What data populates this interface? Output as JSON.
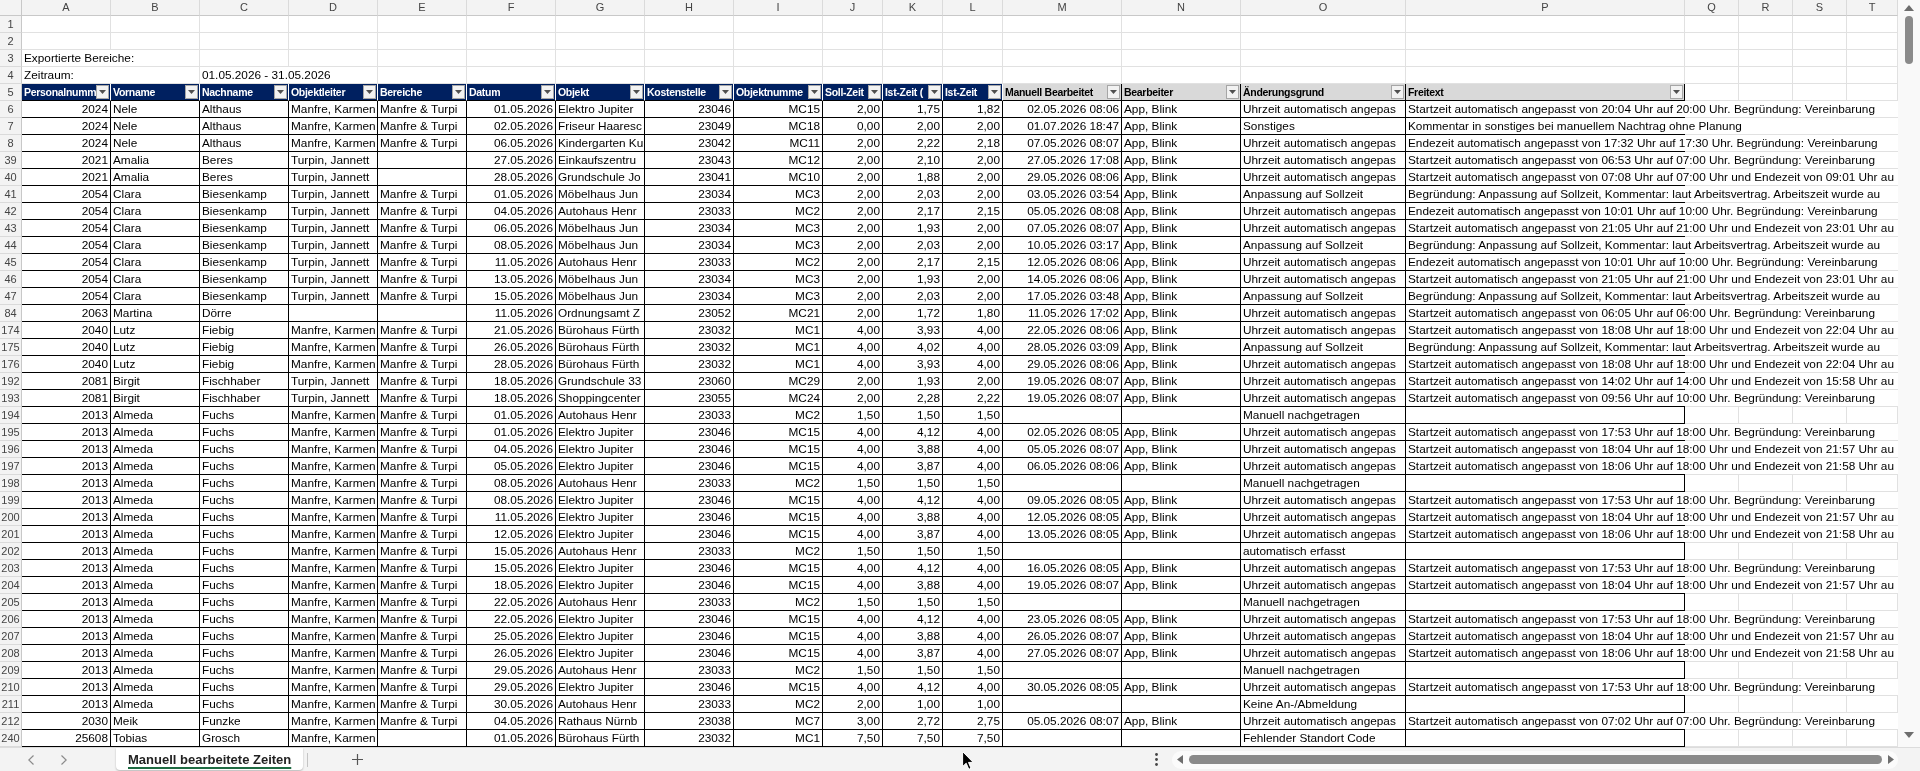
{
  "sheet": {
    "column_letters": [
      "A",
      "B",
      "C",
      "D",
      "E",
      "F",
      "G",
      "H",
      "I",
      "J",
      "K",
      "L",
      "M",
      "N",
      "O",
      "P",
      "Q",
      "R",
      "S",
      "T"
    ],
    "rows": [
      {
        "number": "1"
      },
      {
        "number": "2"
      },
      {
        "number": "3",
        "label": "Exportierte Bereiche:"
      },
      {
        "number": "4",
        "label": "Zeitraum:",
        "value": "01.05.2026 - 31.05.2026"
      }
    ],
    "table": {
      "number": "5",
      "columns": [
        {
          "label": "Personalnumm",
          "color": "#002060"
        },
        {
          "label": "Vorname",
          "color": "#002060"
        },
        {
          "label": "Nachname",
          "color": "#002060"
        },
        {
          "label": "Objektleiter",
          "color": "#002060"
        },
        {
          "label": "Bereiche",
          "color": "#002060"
        },
        {
          "label": "Datum",
          "color": "#002060"
        },
        {
          "label": "Objekt",
          "color": "#002060"
        },
        {
          "label": "Kostenstelle",
          "color": "#002060"
        },
        {
          "label": "Objektnumme",
          "color": "#002060"
        },
        {
          "label": "Soll-Zeit",
          "color": "#002060"
        },
        {
          "label": "Ist-Zeit (",
          "color": "#002060"
        },
        {
          "label": "Ist-Zeit",
          "color": "#002060"
        },
        {
          "label": "Manuell Bearbeitet",
          "color": "#d9d9d9"
        },
        {
          "label": "Bearbeiter",
          "color": "#d9d9d9"
        },
        {
          "label": "Änderungsgrund",
          "color": "#d9d9d9"
        },
        {
          "label": "Freitext",
          "color": "#d9d9d9"
        }
      ],
      "rows": [
        {
          "number": "6",
          "cells": [
            "2024",
            "Nele",
            "Althaus",
            "Manfre, Karmen",
            "Manfre & Turpi",
            "01.05.2026",
            "Elektro Jupiter",
            "23046",
            "MC15",
            "2,00",
            "1,75",
            "1,82",
            "02.05.2026 08:06",
            "App, Blink",
            "Uhrzeit automatisch angepas",
            "Startzeit automatisch angepasst von 20:04 Uhr auf 20:00 Uhr. Begründung: Vereinbarung"
          ]
        },
        {
          "number": "7",
          "cells": [
            "2024",
            "Nele",
            "Althaus",
            "Manfre, Karmen",
            "Manfre & Turpi",
            "02.05.2026",
            "Friseur Haaresc",
            "23049",
            "MC18",
            "0,00",
            "2,00",
            "2,00",
            "01.07.2026 18:47",
            "App, Blink",
            "Sonstiges",
            "Kommentar in sonstiges bei manuellem Nachtrag ohne Planung"
          ]
        },
        {
          "number": "8",
          "cells": [
            "2024",
            "Nele",
            "Althaus",
            "Manfre, Karmen",
            "Manfre & Turpi",
            "06.05.2026",
            "Kindergarten Ku",
            "23042",
            "MC11",
            "2,00",
            "2,22",
            "2,18",
            "07.05.2026 08:07",
            "App, Blink",
            "Uhrzeit automatisch angepas",
            "Endezeit automatisch angepasst von 17:32 Uhr auf 17:30 Uhr. Begründung: Vereinbarung"
          ]
        },
        {
          "number": "39",
          "cells": [
            "2021",
            "Amalia",
            "Beres",
            "Turpin, Jannett",
            null,
            "27.05.2026",
            "Einkaufszentru",
            "23043",
            "MC12",
            "2,00",
            "2,10",
            "2,00",
            "27.05.2026 17:08",
            "App, Blink",
            "Uhrzeit automatisch angepas",
            "Startzeit automatisch angepasst von 06:53 Uhr auf 07:00 Uhr. Begründung: Vereinbarung"
          ]
        },
        {
          "number": "40",
          "cells": [
            "2021",
            "Amalia",
            "Beres",
            "Turpin, Jannett",
            null,
            "28.05.2026",
            "Grundschule Jo",
            "23041",
            "MC10",
            "2,00",
            "1,88",
            "2,00",
            "29.05.2026 08:06",
            "App, Blink",
            "Uhrzeit automatisch angepas",
            "Startzeit automatisch angepasst von 07:08 Uhr auf 07:00 Uhr und Endezeit von 09:01 Uhr au"
          ]
        },
        {
          "number": "41",
          "cells": [
            "2054",
            "Clara",
            "Biesenkamp",
            "Turpin, Jannett",
            "Manfre & Turpi",
            "01.05.2026",
            "Möbelhaus Jun",
            "23034",
            "MC3",
            "2,00",
            "2,03",
            "2,00",
            "03.05.2026 03:54",
            "App, Blink",
            "Anpassung auf Sollzeit",
            "Begründung: Anpassung auf Sollzeit, Kommentar: laut Arbeitsvertrag. Arbeitszeit wurde au"
          ]
        },
        {
          "number": "42",
          "cells": [
            "2054",
            "Clara",
            "Biesenkamp",
            "Turpin, Jannett",
            "Manfre & Turpi",
            "04.05.2026",
            "Autohaus Henr",
            "23033",
            "MC2",
            "2,00",
            "2,17",
            "2,15",
            "05.05.2026 08:08",
            "App, Blink",
            "Uhrzeit automatisch angepas",
            "Endezeit automatisch angepasst von 10:01 Uhr auf 10:00 Uhr. Begründung: Vereinbarung"
          ]
        },
        {
          "number": "43",
          "cells": [
            "2054",
            "Clara",
            "Biesenkamp",
            "Turpin, Jannett",
            "Manfre & Turpi",
            "06.05.2026",
            "Möbelhaus Jun",
            "23034",
            "MC3",
            "2,00",
            "1,93",
            "2,00",
            "07.05.2026 08:07",
            "App, Blink",
            "Uhrzeit automatisch angepas",
            "Startzeit automatisch angepasst von 21:05 Uhr auf 21:00 Uhr und Endezeit von 23:01 Uhr au"
          ]
        },
        {
          "number": "44",
          "cells": [
            "2054",
            "Clara",
            "Biesenkamp",
            "Turpin, Jannett",
            "Manfre & Turpi",
            "08.05.2026",
            "Möbelhaus Jun",
            "23034",
            "MC3",
            "2,00",
            "2,03",
            "2,00",
            "10.05.2026 03:17",
            "App, Blink",
            "Anpassung auf Sollzeit",
            "Begründung: Anpassung auf Sollzeit, Kommentar: laut Arbeitsvertrag. Arbeitszeit wurde au"
          ]
        },
        {
          "number": "45",
          "cells": [
            "2054",
            "Clara",
            "Biesenkamp",
            "Turpin, Jannett",
            "Manfre & Turpi",
            "11.05.2026",
            "Autohaus Henr",
            "23033",
            "MC2",
            "2,00",
            "2,17",
            "2,15",
            "12.05.2026 08:06",
            "App, Blink",
            "Uhrzeit automatisch angepas",
            "Endezeit automatisch angepasst von 10:01 Uhr auf 10:00 Uhr. Begründung: Vereinbarung"
          ]
        },
        {
          "number": "46",
          "cells": [
            "2054",
            "Clara",
            "Biesenkamp",
            "Turpin, Jannett",
            "Manfre & Turpi",
            "13.05.2026",
            "Möbelhaus Jun",
            "23034",
            "MC3",
            "2,00",
            "1,93",
            "2,00",
            "14.05.2026 08:06",
            "App, Blink",
            "Uhrzeit automatisch angepas",
            "Startzeit automatisch angepasst von 21:05 Uhr auf 21:00 Uhr und Endezeit von 23:01 Uhr au"
          ]
        },
        {
          "number": "47",
          "cells": [
            "2054",
            "Clara",
            "Biesenkamp",
            "Turpin, Jannett",
            "Manfre & Turpi",
            "15.05.2026",
            "Möbelhaus Jun",
            "23034",
            "MC3",
            "2,00",
            "2,03",
            "2,00",
            "17.05.2026 03:48",
            "App, Blink",
            "Anpassung auf Sollzeit",
            "Begründung: Anpassung auf Sollzeit, Kommentar: laut Arbeitsvertrag. Arbeitszeit wurde au"
          ]
        },
        {
          "number": "84",
          "cells": [
            "2063",
            "Martina",
            "Dörre",
            null,
            null,
            "11.05.2026",
            "Ordnungsamt Z",
            "23052",
            "MC21",
            "2,00",
            "1,72",
            "1,80",
            "11.05.2026 17:02",
            "App, Blink",
            "Uhrzeit automatisch angepas",
            "Startzeit automatisch angepasst von 06:05 Uhr auf 06:00 Uhr. Begründung: Vereinbarung"
          ]
        },
        {
          "number": "174",
          "cells": [
            "2040",
            "Lutz",
            "Fiebig",
            "Manfre, Karmen",
            "Manfre & Turpi",
            "21.05.2026",
            "Bürohaus Fürth",
            "23032",
            "MC1",
            "4,00",
            "3,93",
            "4,00",
            "22.05.2026 08:06",
            "App, Blink",
            "Uhrzeit automatisch angepas",
            "Startzeit automatisch angepasst von 18:08 Uhr auf 18:00 Uhr und Endezeit von 22:04 Uhr au"
          ]
        },
        {
          "number": "175",
          "cells": [
            "2040",
            "Lutz",
            "Fiebig",
            "Manfre, Karmen",
            "Manfre & Turpi",
            "26.05.2026",
            "Bürohaus Fürth",
            "23032",
            "MC1",
            "4,00",
            "4,02",
            "4,00",
            "28.05.2026 03:09",
            "App, Blink",
            "Anpassung auf Sollzeit",
            "Begründung: Anpassung auf Sollzeit, Kommentar: laut Arbeitsvertrag. Arbeitszeit wurde au"
          ]
        },
        {
          "number": "176",
          "cells": [
            "2040",
            "Lutz",
            "Fiebig",
            "Manfre, Karmen",
            "Manfre & Turpi",
            "28.05.2026",
            "Bürohaus Fürth",
            "23032",
            "MC1",
            "4,00",
            "3,93",
            "4,00",
            "29.05.2026 08:06",
            "App, Blink",
            "Uhrzeit automatisch angepas",
            "Startzeit automatisch angepasst von 18:08 Uhr auf 18:00 Uhr und Endezeit von 22:04 Uhr au"
          ]
        },
        {
          "number": "192",
          "cells": [
            "2081",
            "Birgit",
            "Fischhaber",
            "Turpin, Jannett",
            "Manfre & Turpi",
            "18.05.2026",
            "Grundschule 33",
            "23060",
            "MC29",
            "2,00",
            "1,93",
            "2,00",
            "19.05.2026 08:07",
            "App, Blink",
            "Uhrzeit automatisch angepas",
            "Startzeit automatisch angepasst von 14:02 Uhr auf 14:00 Uhr und Endezeit von 15:58 Uhr au"
          ]
        },
        {
          "number": "193",
          "cells": [
            "2081",
            "Birgit",
            "Fischhaber",
            "Turpin, Jannett",
            "Manfre & Turpi",
            "18.05.2026",
            "Shoppingcenter",
            "23055",
            "MC24",
            "2,00",
            "2,28",
            "2,22",
            "19.05.2026 08:07",
            "App, Blink",
            "Uhrzeit automatisch angepas",
            "Startzeit automatisch angepasst von 09:56 Uhr auf 10:00 Uhr. Begründung: Vereinbarung"
          ]
        },
        {
          "number": "194",
          "cells": [
            "2013",
            "Almeda",
            "Fuchs",
            "Manfre, Karmen",
            "Manfre & Turpi",
            "01.05.2026",
            "Autohaus Henr",
            "23033",
            "MC2",
            "1,50",
            "1,50",
            "1,50",
            null,
            null,
            "Manuell nachgetragen",
            null
          ]
        },
        {
          "number": "195",
          "cells": [
            "2013",
            "Almeda",
            "Fuchs",
            "Manfre, Karmen",
            "Manfre & Turpi",
            "01.05.2026",
            "Elektro Jupiter",
            "23046",
            "MC15",
            "4,00",
            "4,12",
            "4,00",
            "02.05.2026 08:05",
            "App, Blink",
            "Uhrzeit automatisch angepas",
            "Startzeit automatisch angepasst von 17:53 Uhr auf 18:00 Uhr. Begründung: Vereinbarung"
          ]
        },
        {
          "number": "196",
          "cells": [
            "2013",
            "Almeda",
            "Fuchs",
            "Manfre, Karmen",
            "Manfre & Turpi",
            "04.05.2026",
            "Elektro Jupiter",
            "23046",
            "MC15",
            "4,00",
            "3,88",
            "4,00",
            "05.05.2026 08:07",
            "App, Blink",
            "Uhrzeit automatisch angepas",
            "Startzeit automatisch angepasst von 18:04 Uhr auf 18:00 Uhr und Endezeit von 21:57 Uhr au"
          ]
        },
        {
          "number": "197",
          "cells": [
            "2013",
            "Almeda",
            "Fuchs",
            "Manfre, Karmen",
            "Manfre & Turpi",
            "05.05.2026",
            "Elektro Jupiter",
            "23046",
            "MC15",
            "4,00",
            "3,87",
            "4,00",
            "06.05.2026 08:06",
            "App, Blink",
            "Uhrzeit automatisch angepas",
            "Startzeit automatisch angepasst von 18:06 Uhr auf 18:00 Uhr und Endezeit von 21:58 Uhr au"
          ]
        },
        {
          "number": "198",
          "cells": [
            "2013",
            "Almeda",
            "Fuchs",
            "Manfre, Karmen",
            "Manfre & Turpi",
            "08.05.2026",
            "Autohaus Henr",
            "23033",
            "MC2",
            "1,50",
            "1,50",
            "1,50",
            null,
            null,
            "Manuell nachgetragen",
            null
          ]
        },
        {
          "number": "199",
          "cells": [
            "2013",
            "Almeda",
            "Fuchs",
            "Manfre, Karmen",
            "Manfre & Turpi",
            "08.05.2026",
            "Elektro Jupiter",
            "23046",
            "MC15",
            "4,00",
            "4,12",
            "4,00",
            "09.05.2026 08:05",
            "App, Blink",
            "Uhrzeit automatisch angepas",
            "Startzeit automatisch angepasst von 17:53 Uhr auf 18:00 Uhr. Begründung: Vereinbarung"
          ]
        },
        {
          "number": "200",
          "cells": [
            "2013",
            "Almeda",
            "Fuchs",
            "Manfre, Karmen",
            "Manfre & Turpi",
            "11.05.2026",
            "Elektro Jupiter",
            "23046",
            "MC15",
            "4,00",
            "3,88",
            "4,00",
            "12.05.2026 08:05",
            "App, Blink",
            "Uhrzeit automatisch angepas",
            "Startzeit automatisch angepasst von 18:04 Uhr auf 18:00 Uhr und Endezeit von 21:57 Uhr au"
          ]
        },
        {
          "number": "201",
          "cells": [
            "2013",
            "Almeda",
            "Fuchs",
            "Manfre, Karmen",
            "Manfre & Turpi",
            "12.05.2026",
            "Elektro Jupiter",
            "23046",
            "MC15",
            "4,00",
            "3,87",
            "4,00",
            "13.05.2026 08:05",
            "App, Blink",
            "Uhrzeit automatisch angepas",
            "Startzeit automatisch angepasst von 18:06 Uhr auf 18:00 Uhr und Endezeit von 21:58 Uhr au"
          ]
        },
        {
          "number": "202",
          "cells": [
            "2013",
            "Almeda",
            "Fuchs",
            "Manfre, Karmen",
            "Manfre & Turpi",
            "15.05.2026",
            "Autohaus Henr",
            "23033",
            "MC2",
            "1,50",
            "1,50",
            "1,50",
            null,
            null,
            "automatisch erfasst",
            null
          ]
        },
        {
          "number": "203",
          "cells": [
            "2013",
            "Almeda",
            "Fuchs",
            "Manfre, Karmen",
            "Manfre & Turpi",
            "15.05.2026",
            "Elektro Jupiter",
            "23046",
            "MC15",
            "4,00",
            "4,12",
            "4,00",
            "16.05.2026 08:05",
            "App, Blink",
            "Uhrzeit automatisch angepas",
            "Startzeit automatisch angepasst von 17:53 Uhr auf 18:00 Uhr. Begründung: Vereinbarung"
          ]
        },
        {
          "number": "204",
          "cells": [
            "2013",
            "Almeda",
            "Fuchs",
            "Manfre, Karmen",
            "Manfre & Turpi",
            "18.05.2026",
            "Elektro Jupiter",
            "23046",
            "MC15",
            "4,00",
            "3,88",
            "4,00",
            "19.05.2026 08:07",
            "App, Blink",
            "Uhrzeit automatisch angepas",
            "Startzeit automatisch angepasst von 18:04 Uhr auf 18:00 Uhr und Endezeit von 21:57 Uhr au"
          ]
        },
        {
          "number": "205",
          "cells": [
            "2013",
            "Almeda",
            "Fuchs",
            "Manfre, Karmen",
            "Manfre & Turpi",
            "22.05.2026",
            "Autohaus Henr",
            "23033",
            "MC2",
            "1,50",
            "1,50",
            "1,50",
            null,
            null,
            "Manuell nachgetragen",
            null
          ]
        },
        {
          "number": "206",
          "cells": [
            "2013",
            "Almeda",
            "Fuchs",
            "Manfre, Karmen",
            "Manfre & Turpi",
            "22.05.2026",
            "Elektro Jupiter",
            "23046",
            "MC15",
            "4,00",
            "4,12",
            "4,00",
            "23.05.2026 08:05",
            "App, Blink",
            "Uhrzeit automatisch angepas",
            "Startzeit automatisch angepasst von 17:53 Uhr auf 18:00 Uhr. Begründung: Vereinbarung"
          ]
        },
        {
          "number": "207",
          "cells": [
            "2013",
            "Almeda",
            "Fuchs",
            "Manfre, Karmen",
            "Manfre & Turpi",
            "25.05.2026",
            "Elektro Jupiter",
            "23046",
            "MC15",
            "4,00",
            "3,88",
            "4,00",
            "26.05.2026 08:07",
            "App, Blink",
            "Uhrzeit automatisch angepas",
            "Startzeit automatisch angepasst von 18:04 Uhr auf 18:00 Uhr und Endezeit von 21:57 Uhr au"
          ]
        },
        {
          "number": "208",
          "cells": [
            "2013",
            "Almeda",
            "Fuchs",
            "Manfre, Karmen",
            "Manfre & Turpi",
            "26.05.2026",
            "Elektro Jupiter",
            "23046",
            "MC15",
            "4,00",
            "3,87",
            "4,00",
            "27.05.2026 08:07",
            "App, Blink",
            "Uhrzeit automatisch angepas",
            "Startzeit automatisch angepasst von 18:06 Uhr auf 18:00 Uhr und Endezeit von 21:58 Uhr au"
          ]
        },
        {
          "number": "209",
          "cells": [
            "2013",
            "Almeda",
            "Fuchs",
            "Manfre, Karmen",
            "Manfre & Turpi",
            "29.05.2026",
            "Autohaus Henr",
            "23033",
            "MC2",
            "1,50",
            "1,50",
            "1,50",
            null,
            null,
            "Manuell nachgetragen",
            null
          ]
        },
        {
          "number": "210",
          "cells": [
            "2013",
            "Almeda",
            "Fuchs",
            "Manfre, Karmen",
            "Manfre & Turpi",
            "29.05.2026",
            "Elektro Jupiter",
            "23046",
            "MC15",
            "4,00",
            "4,12",
            "4,00",
            "30.05.2026 08:05",
            "App, Blink",
            "Uhrzeit automatisch angepas",
            "Startzeit automatisch angepasst von 17:53 Uhr auf 18:00 Uhr. Begründung: Vereinbarung"
          ]
        },
        {
          "number": "211",
          "cells": [
            "2013",
            "Almeda",
            "Fuchs",
            "Manfre, Karmen",
            "Manfre & Turpi",
            "30.05.2026",
            "Autohaus Henr",
            "23033",
            "MC2",
            "2,00",
            "1,00",
            "1,00",
            null,
            null,
            "Keine An-/Abmeldung",
            null
          ]
        },
        {
          "number": "212",
          "cells": [
            "2030",
            "Meik",
            "Funzke",
            "Manfre, Karmen",
            "Manfre & Turpi",
            "04.05.2026",
            "Rathaus Nürnb",
            "23038",
            "MC7",
            "3,00",
            "2,72",
            "2,75",
            "05.05.2026 08:07",
            "App, Blink",
            "Uhrzeit automatisch angepas",
            "Startzeit automatisch angepasst von 07:02 Uhr auf 07:00 Uhr. Begründung: Vereinbarung"
          ]
        },
        {
          "number": "240",
          "cells": [
            "25608",
            "Tobias",
            "Grosch",
            "Manfre, Karmen",
            null,
            "01.05.2026",
            "Bürohaus Fürth",
            "23032",
            "MC1",
            "7,50",
            "7,50",
            "7,50",
            null,
            null,
            "Fehlender Standort Code",
            null
          ]
        }
      ]
    }
  },
  "sheet_tabs": [
    {
      "label": "Manuell bearbeitete Zeiten",
      "selected": true
    }
  ]
}
